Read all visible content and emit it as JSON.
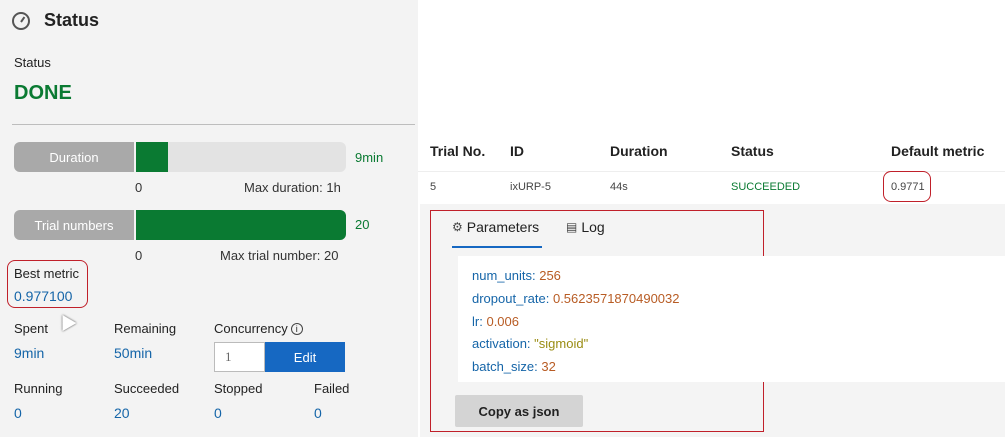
{
  "header": {
    "title": "Status"
  },
  "status": {
    "label": "Status",
    "value": "DONE"
  },
  "duration": {
    "label": "Duration",
    "value": "9min",
    "min": "0",
    "max_label": "Max duration: 1h",
    "progress": 0.15
  },
  "trials": {
    "label": "Trial numbers",
    "value": "20",
    "min": "0",
    "max_label": "Max trial number: 20",
    "progress": 1.0
  },
  "best_metric": {
    "label": "Best metric",
    "value": "0.977100"
  },
  "stats": {
    "spent": {
      "label": "Spent",
      "value": "9min"
    },
    "remaining": {
      "label": "Remaining",
      "value": "50min"
    },
    "concurrency": {
      "label": "Concurrency",
      "value": "1",
      "info_icon": "ⓘ"
    },
    "edit_label": "Edit",
    "running": {
      "label": "Running",
      "value": "0"
    },
    "succeeded": {
      "label": "Succeeded",
      "value": "20"
    },
    "stopped": {
      "label": "Stopped",
      "value": "0"
    },
    "failed": {
      "label": "Failed",
      "value": "0"
    }
  },
  "table": {
    "columns": [
      "Trial No.",
      "ID",
      "Duration",
      "Status",
      "Default metric"
    ],
    "row": {
      "trial_no": "5",
      "id": "ixURP-5",
      "duration": "44s",
      "status": "SUCCEEDED",
      "metric": "0.9771"
    }
  },
  "details": {
    "tabs": [
      {
        "label": "Parameters",
        "icon": "parameters-icon"
      },
      {
        "label": "Log",
        "icon": "log-icon"
      }
    ],
    "params": [
      {
        "key": "num_units:",
        "value": "256",
        "kind": "num"
      },
      {
        "key": "dropout_rate:",
        "value": "0.5623571870490032",
        "kind": "num"
      },
      {
        "key": "lr:",
        "value": "0.006",
        "kind": "num"
      },
      {
        "key": "activation:",
        "value": "\"sigmoid\"",
        "kind": "str"
      },
      {
        "key": "batch_size:",
        "value": "32",
        "kind": "num"
      }
    ],
    "copy_label": "Copy as json"
  },
  "colors": {
    "success": "#0a7a32",
    "link": "#1565a8",
    "primary": "#1668c2",
    "highlight": "#c0202a"
  }
}
